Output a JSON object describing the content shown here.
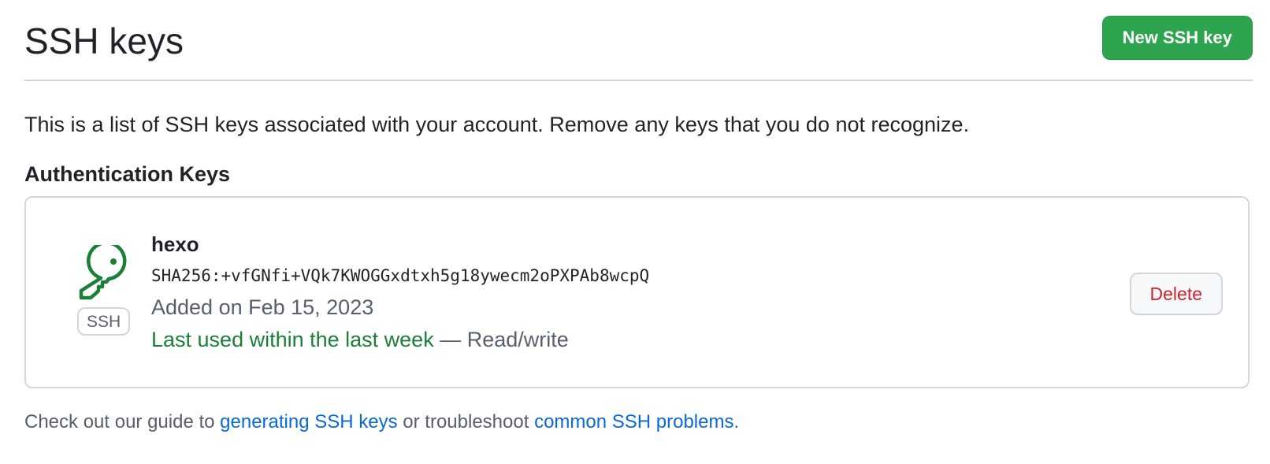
{
  "header": {
    "title": "SSH keys",
    "new_key_button": "New SSH key"
  },
  "intro": {
    "text": "This is a list of SSH keys associated with your account. Remove any keys that you do not recognize."
  },
  "section": {
    "title": "Authentication Keys"
  },
  "keys": [
    {
      "icon": "key-icon",
      "icon_color": "#1a7f37",
      "type_label": "SSH",
      "title": "hexo",
      "fingerprint": "SHA256:+vfGNfi+VQk7KWOGGxdtxh5g18ywecm2oPXPAb8wcpQ",
      "added": "Added on Feb 15, 2023",
      "last_used": "Last used within the last week",
      "separator": " — ",
      "access": "Read/write",
      "delete_label": "Delete"
    }
  ],
  "footer": {
    "prefix": "Check out our guide to ",
    "link1": "generating SSH keys",
    "middle": " or troubleshoot ",
    "link2": "common SSH problems",
    "suffix": "."
  },
  "colors": {
    "primary_button": "#2da44e",
    "danger_text": "#cf222e",
    "link": "#0969da",
    "success_text": "#1a7f37",
    "border": "#d0d7de"
  }
}
